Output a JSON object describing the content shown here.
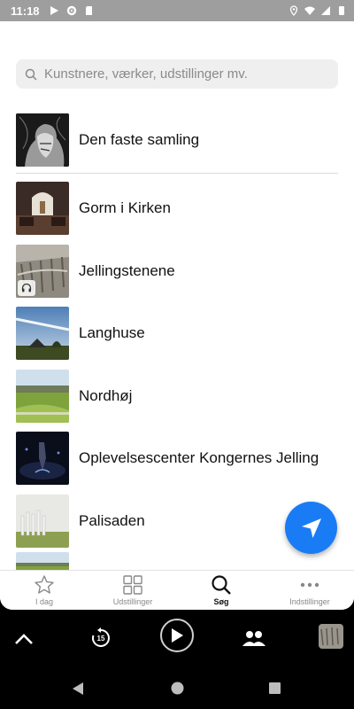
{
  "status_bar": {
    "time": "11:18"
  },
  "search": {
    "placeholder": "Kunstnere, værker, udstillinger mv."
  },
  "items": [
    {
      "label": "Den faste samling"
    },
    {
      "label": "Gorm i Kirken"
    },
    {
      "label": "Jellingstenene"
    },
    {
      "label": "Langhuse"
    },
    {
      "label": "Nordhøj"
    },
    {
      "label": "Oplevelsescenter Kongernes Jelling"
    },
    {
      "label": "Palisaden"
    }
  ],
  "tabs": [
    {
      "label": "I dag",
      "icon": "star-icon"
    },
    {
      "label": "Udstillinger",
      "icon": "grid-icon"
    },
    {
      "label": "Søg",
      "icon": "search-icon"
    },
    {
      "label": "Indstillinger",
      "icon": "more-icon"
    }
  ],
  "player": {
    "replay_seconds": "15"
  },
  "colors": {
    "accent": "#1a7cf5",
    "status_bar": "#9e9e9e"
  }
}
